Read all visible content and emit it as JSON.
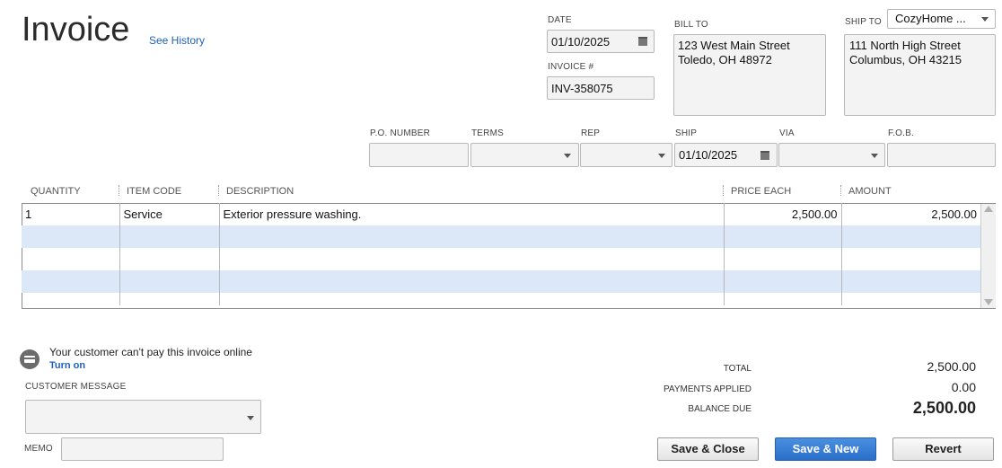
{
  "header": {
    "title": "Invoice",
    "see_history": "See History"
  },
  "date": {
    "label": "DATE",
    "value": "01/10/2025"
  },
  "invoice_no": {
    "label": "INVOICE #",
    "value": "INV-358075"
  },
  "bill_to": {
    "label": "BILL TO",
    "line1": "123 West Main Street",
    "line2": "Toledo, OH 48972"
  },
  "ship_to": {
    "label": "SHIP TO",
    "selector": "CozyHome ...",
    "line1": "111 North High Street",
    "line2": "Columbus, OH 43215"
  },
  "fields": {
    "po_number": {
      "label": "P.O. NUMBER",
      "value": ""
    },
    "terms": {
      "label": "TERMS",
      "value": ""
    },
    "rep": {
      "label": "REP",
      "value": ""
    },
    "ship": {
      "label": "SHIP",
      "value": "01/10/2025"
    },
    "via": {
      "label": "VIA",
      "value": ""
    },
    "fob": {
      "label": "F.O.B.",
      "value": ""
    }
  },
  "grid": {
    "columns": [
      "QUANTITY",
      "ITEM CODE",
      "DESCRIPTION",
      "PRICE EACH",
      "AMOUNT"
    ],
    "rows": [
      {
        "quantity": "1",
        "item_code": "Service",
        "description": "Exterior pressure washing.",
        "price_each": "2,500.00",
        "amount": "2,500.00"
      },
      {
        "quantity": "",
        "item_code": "",
        "description": "",
        "price_each": "",
        "amount": ""
      },
      {
        "quantity": "",
        "item_code": "",
        "description": "",
        "price_each": "",
        "amount": ""
      },
      {
        "quantity": "",
        "item_code": "",
        "description": "",
        "price_each": "",
        "amount": ""
      },
      {
        "quantity": "",
        "item_code": "",
        "description": "",
        "price_each": "",
        "amount": ""
      }
    ]
  },
  "online_payment": {
    "message": "Your customer can't pay this invoice online",
    "turn_on": "Turn on",
    "icon": "credit-card-icon"
  },
  "customer_message": {
    "label": "CUSTOMER MESSAGE",
    "value": ""
  },
  "memo": {
    "label": "MEMO",
    "value": ""
  },
  "totals": {
    "total_label": "TOTAL",
    "total": "2,500.00",
    "payments_label": "PAYMENTS APPLIED",
    "payments": "0.00",
    "balance_label": "BALANCE DUE",
    "balance": "2,500.00"
  },
  "buttons": {
    "save_close": "Save & Close",
    "save_new": "Save & New",
    "revert": "Revert"
  },
  "colors": {
    "link": "#1f5fbf",
    "row_alt": "#dce8f8",
    "primary_button": "#2a6fc9"
  }
}
